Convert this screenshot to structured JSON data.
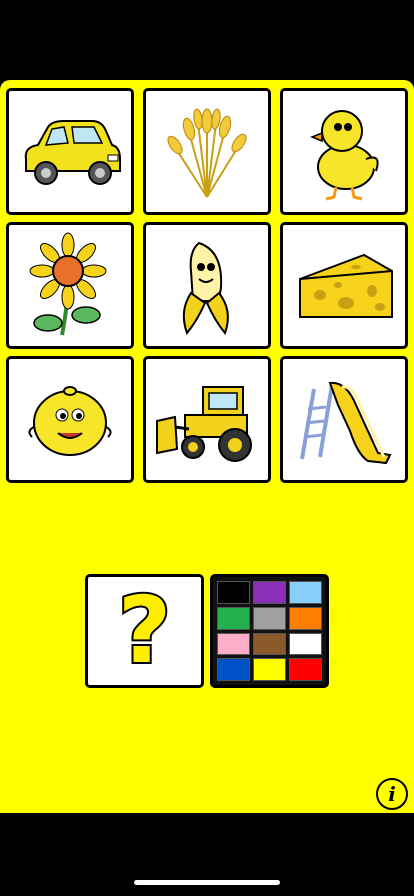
{
  "grid": {
    "items": [
      {
        "name": "car",
        "icon": "car-icon"
      },
      {
        "name": "wheat",
        "icon": "wheat-icon"
      },
      {
        "name": "chick",
        "icon": "chick-icon"
      },
      {
        "name": "sunflower",
        "icon": "sunflower-icon"
      },
      {
        "name": "banana",
        "icon": "banana-icon"
      },
      {
        "name": "cheese",
        "icon": "cheese-icon"
      },
      {
        "name": "lemon",
        "icon": "lemon-icon"
      },
      {
        "name": "bulldozer",
        "icon": "bulldozer-icon"
      },
      {
        "name": "slide",
        "icon": "slide-icon"
      }
    ]
  },
  "question": {
    "symbol": "?"
  },
  "palette": {
    "colors": [
      "#000000",
      "#8b2fb8",
      "#87cefa",
      "#22b14c",
      "#a0a0a0",
      "#ff8000",
      "#ffaec9",
      "#8b5a2b",
      "#ffffff",
      "#0050c8",
      "#ffff00",
      "#ff0000"
    ]
  },
  "info": {
    "symbol": "i"
  },
  "colors": {
    "background": "#ffff00",
    "accent_yellow": "#ffee00"
  }
}
